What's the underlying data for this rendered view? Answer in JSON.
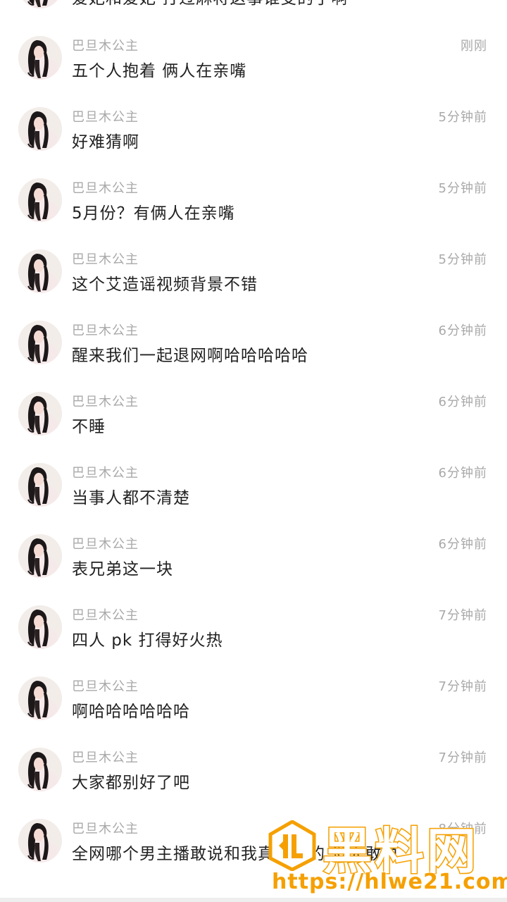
{
  "comments": [
    {
      "user": "",
      "time": "",
      "text": "爱妃和爱妃 打过麻将这事谁受的了啊"
    },
    {
      "user": "巴旦木公主",
      "time": "刚刚",
      "text": "五个人抱着 俩人在亲嘴"
    },
    {
      "user": "巴旦木公主",
      "time": "5分钟前",
      "text": "好难猜啊"
    },
    {
      "user": "巴旦木公主",
      "time": "5分钟前",
      "text": "5月份？有俩人在亲嘴"
    },
    {
      "user": "巴旦木公主",
      "time": "5分钟前",
      "text": "这个艾造谣视频背景不错"
    },
    {
      "user": "巴旦木公主",
      "time": "6分钟前",
      "text": "醒来我们一起退网啊哈哈哈哈哈"
    },
    {
      "user": "巴旦木公主",
      "time": "6分钟前",
      "text": "不睡"
    },
    {
      "user": "巴旦木公主",
      "time": "6分钟前",
      "text": "当事人都不清楚"
    },
    {
      "user": "巴旦木公主",
      "time": "6分钟前",
      "text": "表兄弟这一块"
    },
    {
      "user": "巴旦木公主",
      "time": "7分钟前",
      "text": "四人 pk 打得好火热"
    },
    {
      "user": "巴旦木公主",
      "time": "7分钟前",
      "text": "啊哈哈哈哈哈哈"
    },
    {
      "user": "巴旦木公主",
      "time": "7分钟前",
      "text": "大家都别好了吧"
    },
    {
      "user": "巴旦木公主",
      "time": "8分钟前",
      "text": "全网哪个男主播敢说和我真有啥的 没人敢说"
    }
  ],
  "watermark": {
    "title": "黑料网",
    "url": "https://hlwe21.com",
    "color": "#f5a000"
  },
  "icons": {
    "avatar": "avatar-woman-portrait-icon",
    "logo": "watermark-logo-icon"
  }
}
